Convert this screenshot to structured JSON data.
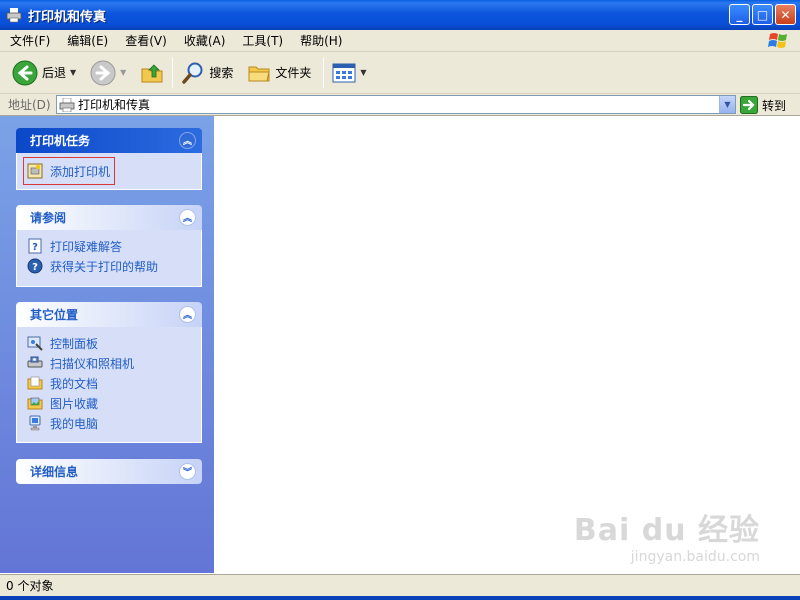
{
  "window": {
    "title": "打印机和传真"
  },
  "menu": [
    "文件(F)",
    "编辑(E)",
    "查看(V)",
    "收藏(A)",
    "工具(T)",
    "帮助(H)"
  ],
  "toolbar": {
    "back": "后退",
    "search": "搜索",
    "folders": "文件夹"
  },
  "address": {
    "label": "地址(D)",
    "value": "打印机和传真",
    "go": "转到"
  },
  "panels": {
    "printer_tasks": {
      "title": "打印机任务",
      "items": [
        "添加打印机"
      ]
    },
    "see_also": {
      "title": "请参阅",
      "items": [
        "打印疑难解答",
        "获得关于打印的帮助"
      ]
    },
    "other_places": {
      "title": "其它位置",
      "items": [
        "控制面板",
        "扫描仪和照相机",
        "我的文档",
        "图片收藏",
        "我的电脑"
      ]
    },
    "details": {
      "title": "详细信息"
    }
  },
  "status": {
    "text": "0 个对象"
  },
  "watermark": {
    "main": "Bai du 经验",
    "sub": "jingyan.baidu.com"
  },
  "colors": {
    "titlebar": "#0a4fd8",
    "pane_top": "#7ba2e7",
    "pane_bottom": "#6375d6",
    "link": "#215dc6",
    "selection_border": "#d63b3b"
  }
}
